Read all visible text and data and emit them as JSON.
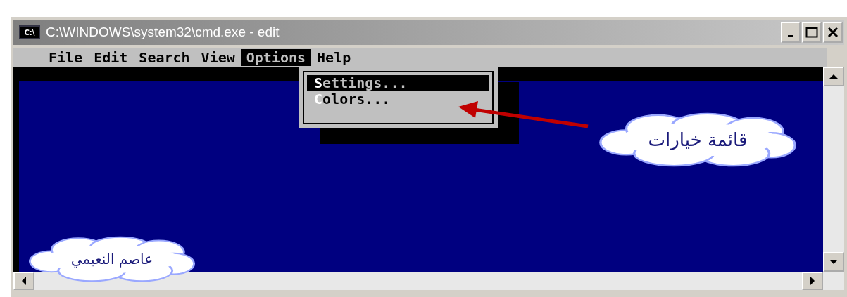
{
  "window": {
    "icon_text": "C:\\",
    "title": "C:\\WINDOWS\\system32\\cmd.exe - edit"
  },
  "menu_bar": [
    {
      "label": "File",
      "selected": false
    },
    {
      "label": "Edit",
      "selected": false
    },
    {
      "label": "Search",
      "selected": false
    },
    {
      "label": "View",
      "selected": false
    },
    {
      "label": "Options",
      "selected": true
    },
    {
      "label": "Help",
      "selected": false
    }
  ],
  "options_menu": [
    {
      "label": "Settings...",
      "selected": true
    },
    {
      "label": "Colors...",
      "selected": false
    }
  ],
  "callouts": [
    {
      "kind": "pointer",
      "text": "قائمة خيارات"
    },
    {
      "kind": "signature",
      "text": "عاصم النعيمي"
    }
  ]
}
